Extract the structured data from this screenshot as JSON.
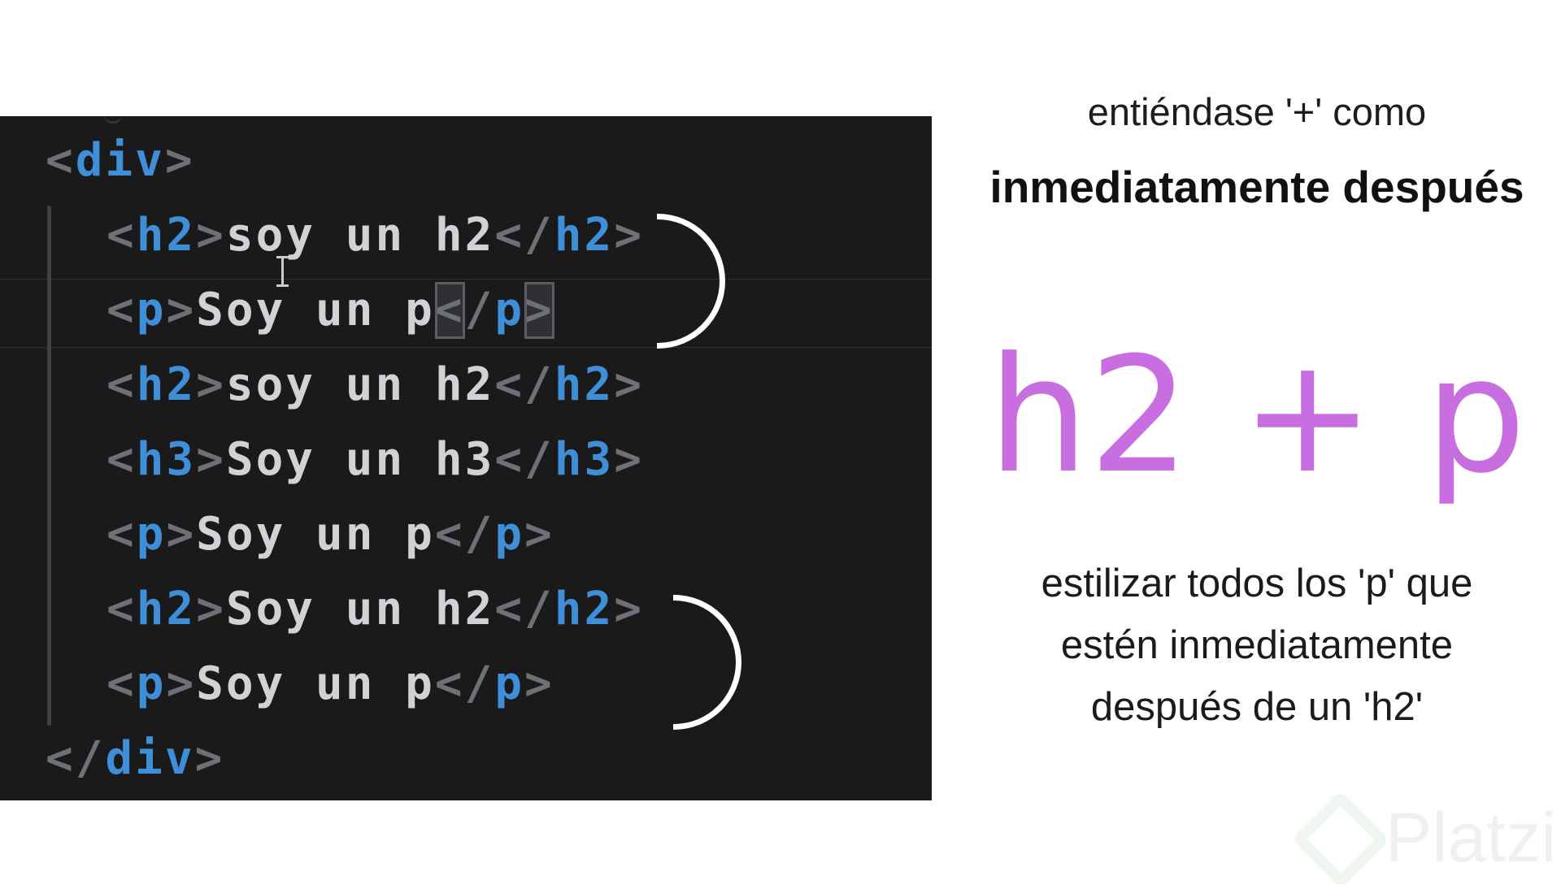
{
  "code_panel": {
    "language": "html",
    "lines": [
      {
        "indent": 0,
        "open_tag": "div",
        "text": "",
        "close_tag": "",
        "cursor": false
      },
      {
        "indent": 1,
        "open_tag": "h2",
        "text": "soy un h2",
        "close_tag": "h2",
        "cursor": false
      },
      {
        "indent": 1,
        "open_tag": "p",
        "text": "Soy un p",
        "close_tag": "p",
        "cursor": true
      },
      {
        "indent": 1,
        "open_tag": "h2",
        "text": "soy un h2",
        "close_tag": "h2",
        "cursor": false
      },
      {
        "indent": 1,
        "open_tag": "h3",
        "text": "Soy un h3",
        "close_tag": "h3",
        "cursor": false
      },
      {
        "indent": 1,
        "open_tag": "p",
        "text": "Soy un p",
        "close_tag": "p",
        "cursor": false
      },
      {
        "indent": 1,
        "open_tag": "h2",
        "text": "Soy un h2",
        "close_tag": "h2",
        "cursor": false
      },
      {
        "indent": 1,
        "open_tag": "p",
        "text": "Soy un p",
        "close_tag": "p",
        "cursor": false
      },
      {
        "indent": 0,
        "open_tag": "",
        "text": "",
        "close_tag": "div",
        "cursor": false
      }
    ],
    "colors": {
      "background": "#1a1a1b",
      "bracket": "#6d7076",
      "tag": "#3f8fd8",
      "text": "#d0d2d6",
      "annotation_brackets": "#ffffff"
    }
  },
  "explanation": {
    "intro": "entiéndase '+' como",
    "highlight": "inmediatamente después",
    "selector": "h2 + p",
    "description": [
      "estilizar todos los 'p' que",
      "estén inmediatamente",
      "después de un 'h2'"
    ],
    "selector_color": "#c86ee0"
  },
  "watermark": {
    "brand": "Platzi",
    "icon": "platzi-logo-icon"
  }
}
